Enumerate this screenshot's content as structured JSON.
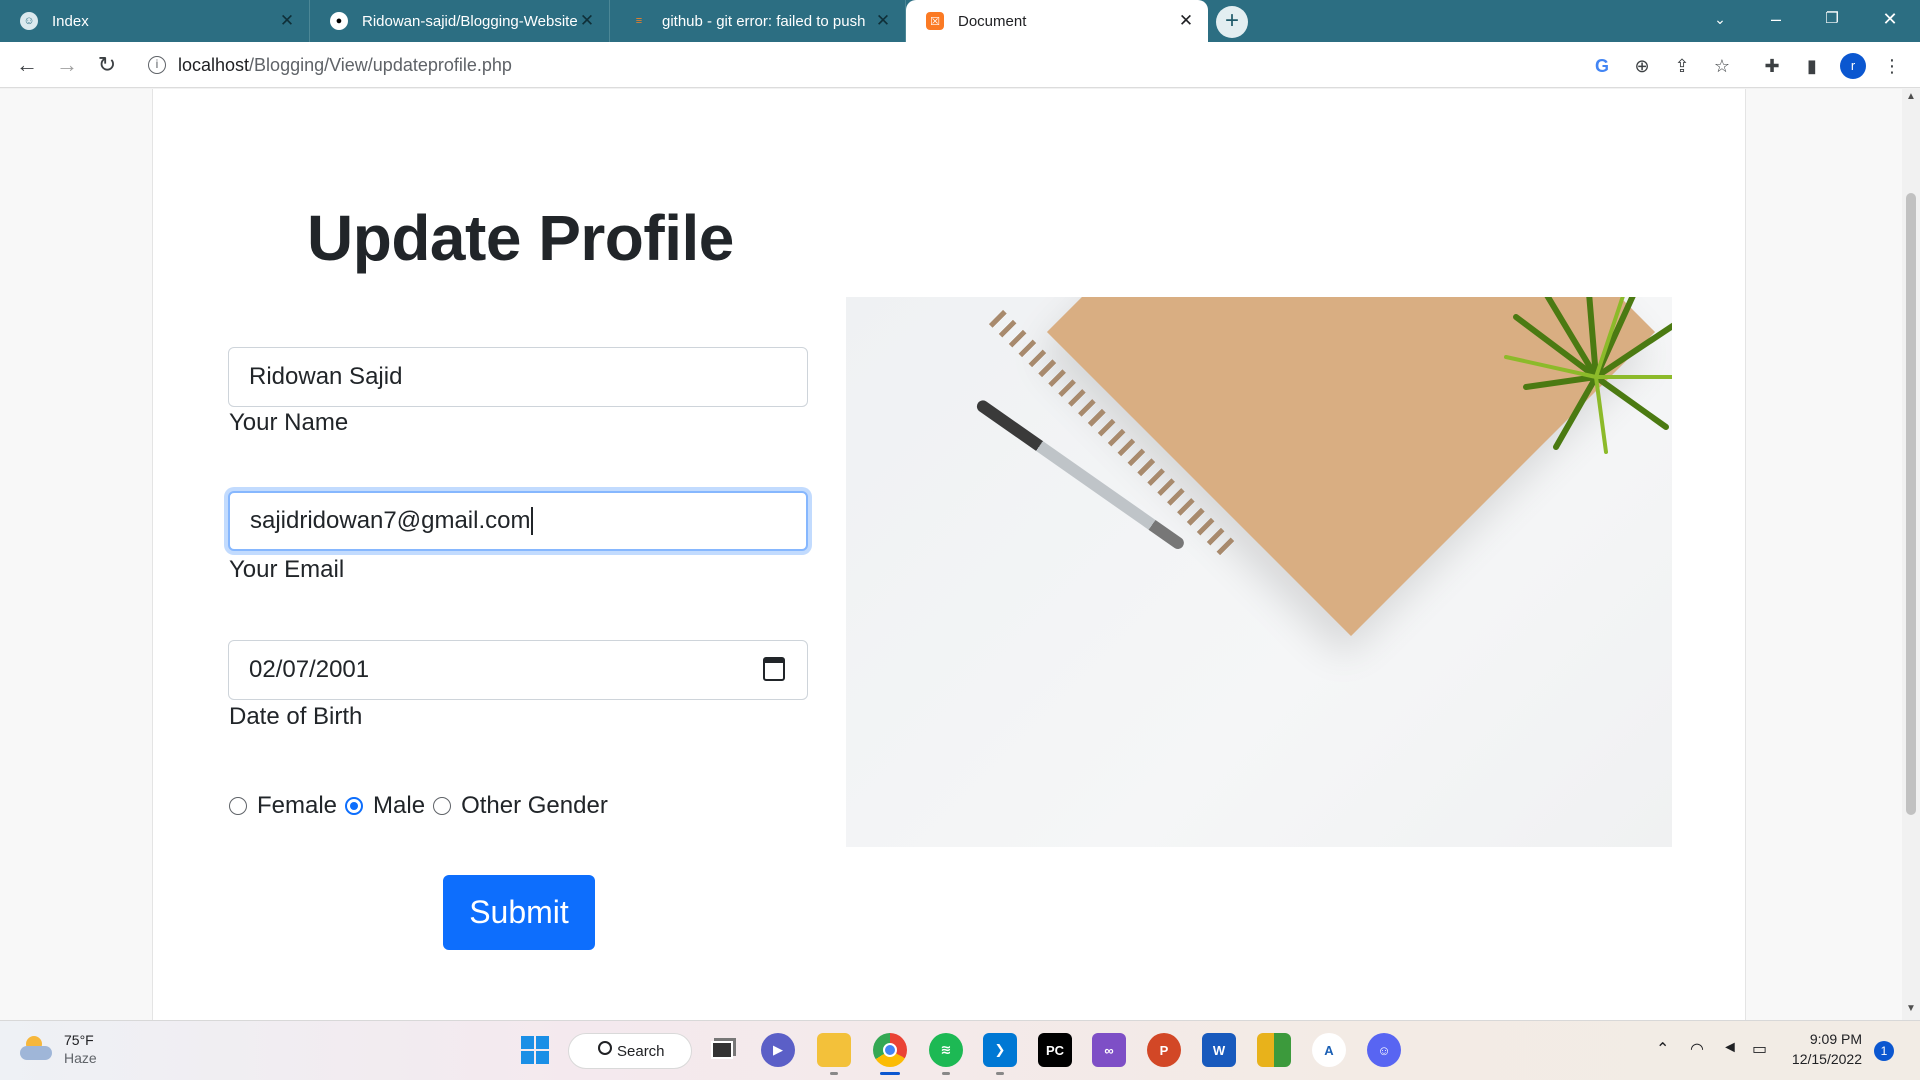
{
  "browser": {
    "tabs": [
      {
        "title": "Index",
        "favicon": "xampp-icon",
        "active": false
      },
      {
        "title": "Ridowan-sajid/Blogging-Website",
        "favicon": "github-icon",
        "active": false
      },
      {
        "title": "github - git error: failed to push",
        "favicon": "stackoverflow-icon",
        "active": false
      },
      {
        "title": "Document",
        "favicon": "xampp-icon",
        "active": true
      }
    ],
    "url_host": "localhost",
    "url_path": "/Blogging/View/updateprofile.php",
    "profile_initial": "r"
  },
  "page": {
    "heading": "Update Profile",
    "name_value": "Ridowan Sajid",
    "name_label": "Your Name",
    "email_value": "sajidridowan7@gmail.com",
    "email_label": "Your Email",
    "dob_value": "02/07/2001",
    "dob_label": "Date of Birth",
    "gender_options": [
      "Female",
      "Male",
      "Other Gender"
    ],
    "gender_selected": "Male",
    "submit_label": "Submit"
  },
  "taskbar": {
    "weather_temp": "75°F",
    "weather_desc": "Haze",
    "search_label": "Search",
    "time": "9:09 PM",
    "date": "12/15/2022",
    "notification_count": "1"
  },
  "colors": {
    "tabstrip": "#2c6e82",
    "primary_button": "#0d6efd",
    "focus_ring": "#86b7fe"
  }
}
